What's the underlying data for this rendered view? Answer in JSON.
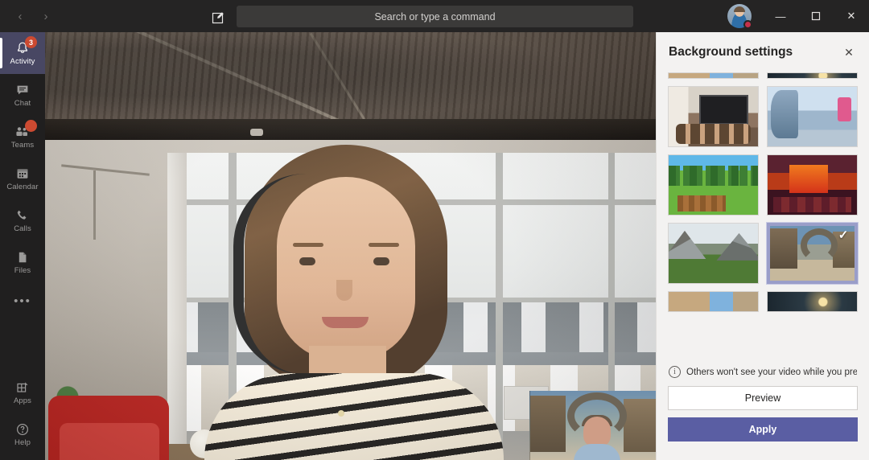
{
  "titlebar": {
    "back_icon": "chevron-left-icon",
    "forward_icon": "chevron-right-icon",
    "back_label": "‹",
    "forward_label": "›",
    "compose_label": "✎",
    "minimize_label": "—",
    "maximize_label": "❐",
    "close_label": "✕"
  },
  "search": {
    "placeholder": "Search or type a command",
    "value": "Search or type a command"
  },
  "sidebar": {
    "items": [
      {
        "label": "Activity",
        "icon": "bell-icon",
        "badge": "3",
        "active": true
      },
      {
        "label": "Chat",
        "icon": "chat-icon",
        "badge": "",
        "active": false
      },
      {
        "label": "Teams",
        "icon": "teams-icon",
        "badge": "●",
        "active": false
      },
      {
        "label": "Calendar",
        "icon": "calendar-icon",
        "badge": "",
        "active": false
      },
      {
        "label": "Calls",
        "icon": "phone-icon",
        "badge": "",
        "active": false
      },
      {
        "label": "Files",
        "icon": "files-icon",
        "badge": "",
        "active": false
      }
    ],
    "more_label": "•••",
    "bottom_items": [
      {
        "label": "Apps",
        "icon": "apps-grid-icon"
      },
      {
        "label": "Help",
        "icon": "help-circle-icon"
      }
    ]
  },
  "panel": {
    "title": "Background settings",
    "close_label": "✕",
    "selected_check": "✓",
    "note_icon": "info-icon",
    "note_icon_label": "i",
    "note_text": "Others won't see your video while you previe…",
    "preview_label": "Preview",
    "apply_label": "Apply",
    "accent_color": "#5a5ea3",
    "selection_border_color": "#9a9ec9",
    "background_color": "#f3f2f1",
    "backgrounds": [
      {
        "name": "clipped-row-left",
        "art": "bg-castle",
        "selected": false,
        "clip": "top"
      },
      {
        "name": "clipped-row-right",
        "art": "bg-nightspace",
        "selected": false,
        "clip": "top"
      },
      {
        "name": "conference-room",
        "art": "bg-conference",
        "selected": false,
        "clip": ""
      },
      {
        "name": "space-station",
        "art": "bg-space",
        "selected": false,
        "clip": ""
      },
      {
        "name": "minecraft-overworld",
        "art": "bg-minecraft",
        "selected": false,
        "clip": ""
      },
      {
        "name": "minecraft-nether",
        "art": "bg-nether",
        "selected": false,
        "clip": ""
      },
      {
        "name": "mountain-valley",
        "art": "bg-valley",
        "selected": false,
        "clip": ""
      },
      {
        "name": "halo-ring",
        "art": "bg-halo",
        "selected": true,
        "clip": ""
      },
      {
        "name": "desert-castle",
        "art": "bg-castle",
        "selected": false,
        "clip": "bottom"
      },
      {
        "name": "night-sky",
        "art": "bg-nightspace",
        "selected": false,
        "clip": "bottom"
      }
    ]
  },
  "stage": {
    "self_video_name": "self-video",
    "participant_video_name": "participant-video-thumbnail"
  },
  "user": {
    "presence": "busy",
    "presence_color": "#c4314b"
  }
}
